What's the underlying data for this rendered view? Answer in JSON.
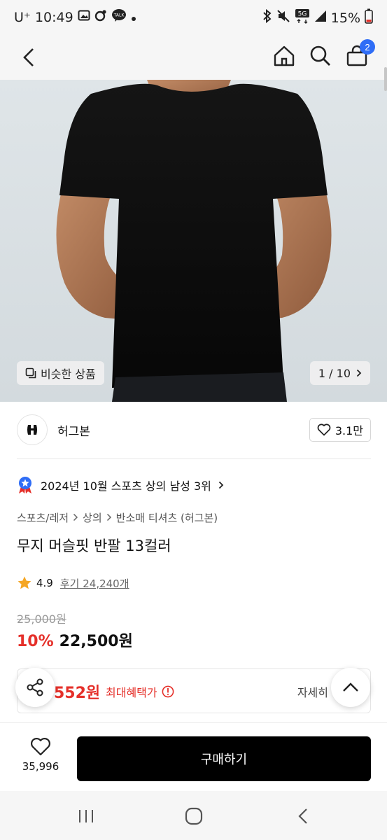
{
  "status_bar": {
    "carrier": "U⁺",
    "time": "10:49",
    "battery": "15%",
    "icons_left": [
      "gallery-icon",
      "sync-icon",
      "talk-icon",
      "dot-icon"
    ],
    "icons_right": [
      "bluetooth-icon",
      "mute-icon",
      "5g-signal-icon",
      "signal-icon",
      "battery-icon"
    ]
  },
  "nav": {
    "cart_count": "2"
  },
  "hero": {
    "similar_label": "비슷한 상품",
    "pager": "1 / 10"
  },
  "brand": {
    "name": "허그본",
    "likes": "3.1만"
  },
  "rank": {
    "text": "2024년 10월 스포츠 상의 남성 3위"
  },
  "breadcrumb": [
    "스포츠/레저",
    "상의",
    "반소매 티셔츠 (허그본)"
  ],
  "product": {
    "title": "무지 머슬핏 반팔 13컬러",
    "rating": "4.9",
    "reviews": "후기 24,240개",
    "original_price": "25,000원",
    "discount": "10%",
    "price": "22,500원"
  },
  "benefit": {
    "price_partial": "552원",
    "label": "최대혜택가",
    "detail": "자세히"
  },
  "bottom": {
    "wish_count": "35,996",
    "buy_label": "구매하기"
  },
  "colors": {
    "accent_red": "#e5302a",
    "badge_blue": "#2f6df6",
    "buy_button": "#000000",
    "star": "#f5a623"
  }
}
